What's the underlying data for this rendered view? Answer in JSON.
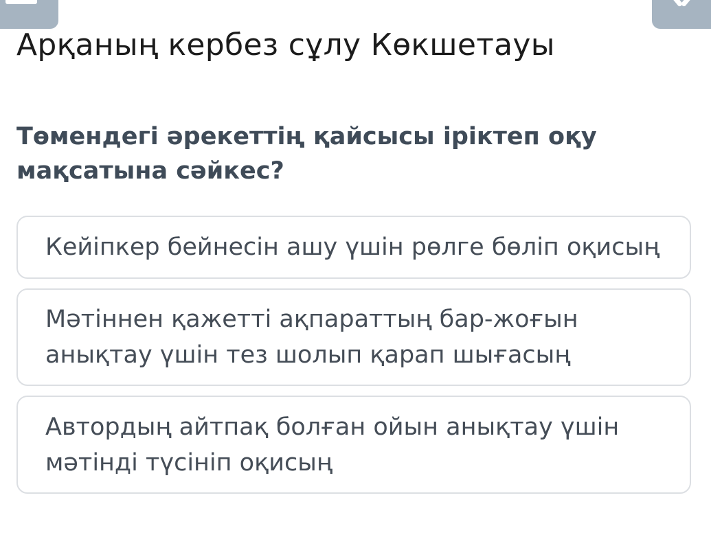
{
  "header": {
    "title": "Арқаның кербез сұлу Көкшетауы",
    "left_button_icon": "menu-icon",
    "right_button_icon": "close-icon"
  },
  "question": {
    "text": "Төмендегі әрекеттің қайсысы іріктеп оқу мақсатына сәйкес?"
  },
  "options": [
    {
      "label": "Кейіпкер бейнесін ашу үшін рөлге бөліп оқисың"
    },
    {
      "label": "Мәтіннен қажетті ақпараттың бар-жоғын анықтау үшін тез шолып қарап шығасың"
    },
    {
      "label": "Автордың айтпақ болған ойын анықтау үшін мәтінді түсініп оқисың"
    }
  ],
  "colors": {
    "top_button": "#a6b4c1",
    "question_text": "#3f4b58",
    "option_border": "#dcdfe3",
    "option_text": "#454d57"
  }
}
